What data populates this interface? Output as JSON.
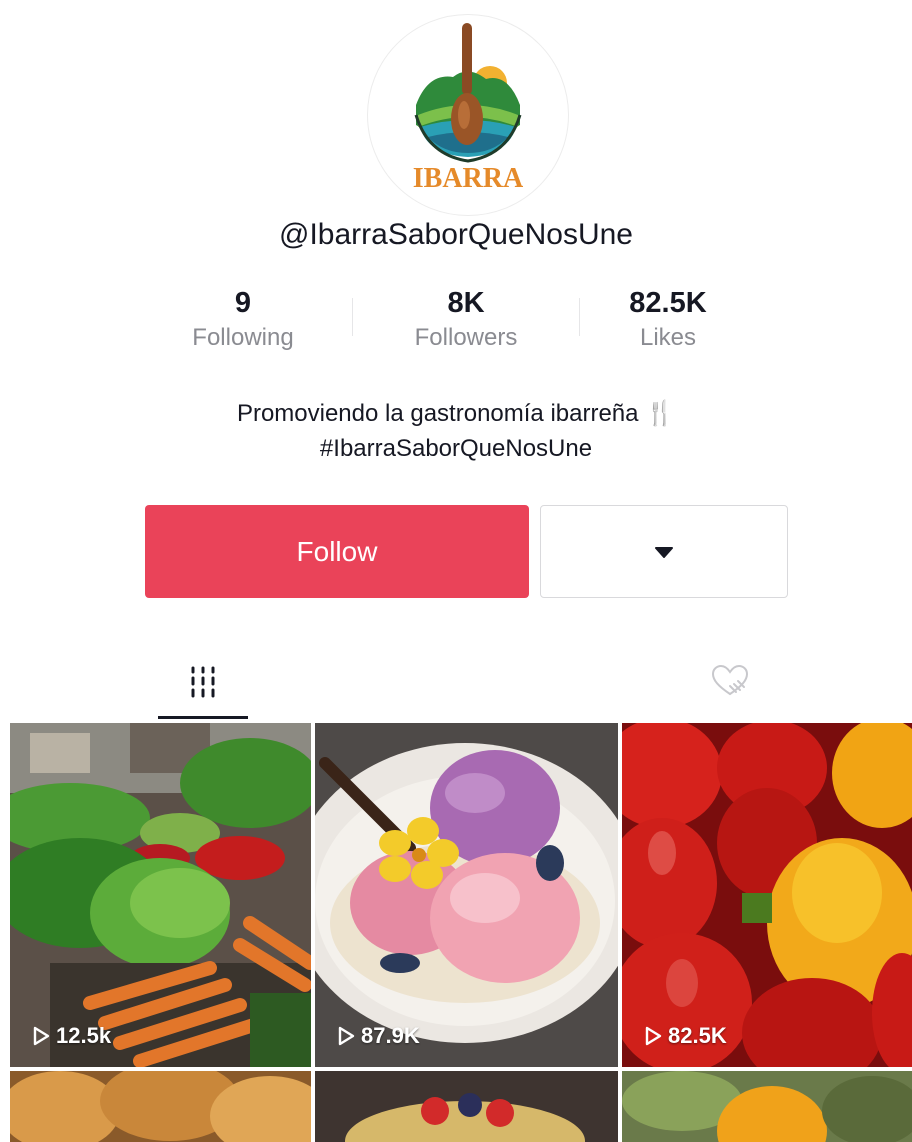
{
  "profile": {
    "logo_text": "IBARRA",
    "username": "@IbarraSaborQueNosUne",
    "stats": [
      {
        "value": "9",
        "label": "Following"
      },
      {
        "value": "8K",
        "label": "Followers"
      },
      {
        "value": "82.5K",
        "label": "Likes"
      }
    ],
    "bio_line1": "Promoviendo la gastronomía ibarreña 🍴",
    "bio_line2": "#IbarraSaborQueNosUne"
  },
  "actions": {
    "follow_label": "Follow"
  },
  "tabs": [
    {
      "icon": "grid-icon",
      "active": true
    },
    {
      "icon": "liked-heart-icon",
      "active": false
    }
  ],
  "videos": [
    {
      "views": "12.5k",
      "thumb": "market-vegetables"
    },
    {
      "views": "87.9K",
      "thumb": "ice-cream-flower"
    },
    {
      "views": "82.5K",
      "thumb": "bell-peppers"
    },
    {
      "views": "",
      "thumb": "bread"
    },
    {
      "views": "",
      "thumb": "dessert"
    },
    {
      "views": "",
      "thumb": "oranges"
    }
  ],
  "colors": {
    "follow": "#ea4359",
    "text": "#161823",
    "muted": "#8a8b91"
  }
}
